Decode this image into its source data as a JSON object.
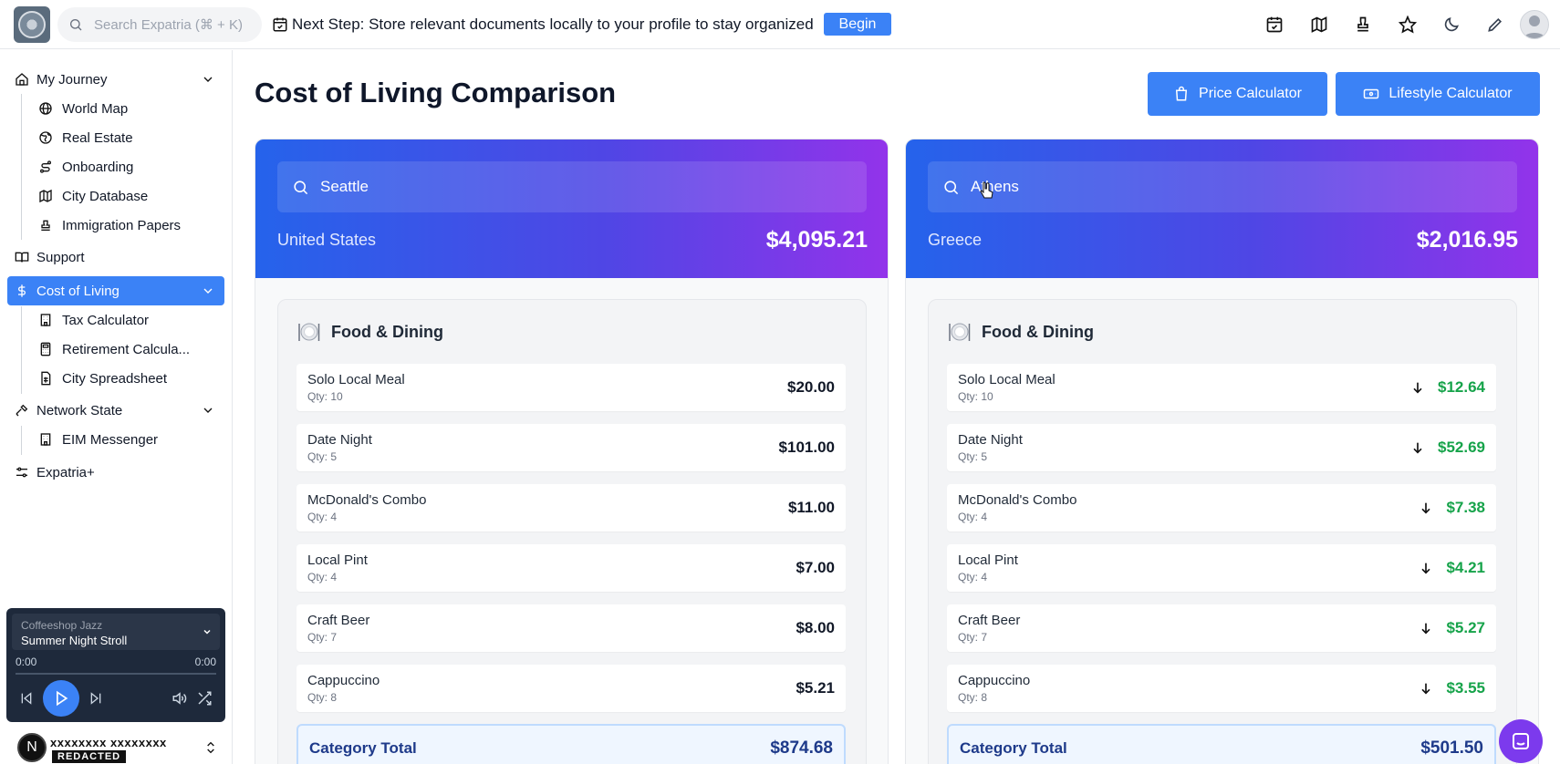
{
  "topbar": {
    "search_placeholder": "Search Expatria (⌘ + K)",
    "next_step": "Next Step: Store relevant documents locally to your profile to stay organized",
    "begin_label": "Begin",
    "icons": [
      "calendar-check-icon",
      "map-icon",
      "stamp-icon",
      "star-icon",
      "moon-icon",
      "pencil-icon",
      "user-avatar-icon"
    ]
  },
  "sidebar": {
    "my_journey": "My Journey",
    "journey_items": [
      {
        "label": "World Map",
        "icon": "globe-icon"
      },
      {
        "label": "Real Estate",
        "icon": "earth-icon"
      },
      {
        "label": "Onboarding",
        "icon": "route-icon"
      },
      {
        "label": "City Database",
        "icon": "map-icon"
      },
      {
        "label": "Immigration Papers",
        "icon": "stamp-icon"
      }
    ],
    "support": "Support",
    "cost_of_living": "Cost of Living",
    "col_items": [
      {
        "label": "Tax Calculator",
        "icon": "building-icon"
      },
      {
        "label": "Retirement Calcula...",
        "icon": "calculator-icon"
      },
      {
        "label": "City Spreadsheet",
        "icon": "sheet-icon"
      }
    ],
    "network_state": "Network State",
    "network_items": [
      {
        "label": "EIM Messenger",
        "icon": "building-icon"
      }
    ],
    "expatria_plus": "Expatria+"
  },
  "player": {
    "playlist": "Coffeeshop Jazz",
    "track": "Summer Night Stroll",
    "elapsed": "0:00",
    "duration": "0:00",
    "progress": 0
  },
  "user": {
    "initial": "N",
    "name": "xxxxxxxx xxxxxxxx",
    "badge": "REDACTED"
  },
  "main": {
    "title": "Cost of Living Comparison",
    "price_calc_label": "Price Calculator",
    "lifestyle_calc_label": "Lifestyle Calculator"
  },
  "cities": [
    {
      "city": "Seattle",
      "country": "United States",
      "total": "$4,095.21",
      "category": "Food & Dining",
      "items": [
        {
          "name": "Solo Local Meal",
          "qty": "Qty: 10",
          "price": "$20.00"
        },
        {
          "name": "Date Night",
          "qty": "Qty: 5",
          "price": "$101.00"
        },
        {
          "name": "McDonald's Combo",
          "qty": "Qty: 4",
          "price": "$11.00"
        },
        {
          "name": "Local Pint",
          "qty": "Qty: 4",
          "price": "$7.00"
        },
        {
          "name": "Craft Beer",
          "qty": "Qty: 7",
          "price": "$8.00"
        },
        {
          "name": "Cappuccino",
          "qty": "Qty: 8",
          "price": "$5.21"
        }
      ],
      "category_total_label": "Category Total",
      "category_total": "$874.68"
    },
    {
      "city": "Athens",
      "country": "Greece",
      "total": "$2,016.95",
      "category": "Food & Dining",
      "items": [
        {
          "name": "Solo Local Meal",
          "qty": "Qty: 10",
          "price": "$12.64"
        },
        {
          "name": "Date Night",
          "qty": "Qty: 5",
          "price": "$52.69"
        },
        {
          "name": "McDonald's Combo",
          "qty": "Qty: 4",
          "price": "$7.38"
        },
        {
          "name": "Local Pint",
          "qty": "Qty: 4",
          "price": "$4.21"
        },
        {
          "name": "Craft Beer",
          "qty": "Qty: 7",
          "price": "$5.27"
        },
        {
          "name": "Cappuccino",
          "qty": "Qty: 8",
          "price": "$3.55"
        }
      ],
      "category_total_label": "Category Total",
      "category_total": "$501.50"
    }
  ],
  "colors": {
    "accent": "#3b82f6",
    "gradient_start": "#2563eb",
    "gradient_end": "#9333ea",
    "price_down": "#16a34a",
    "chat": "#7c3aed"
  }
}
